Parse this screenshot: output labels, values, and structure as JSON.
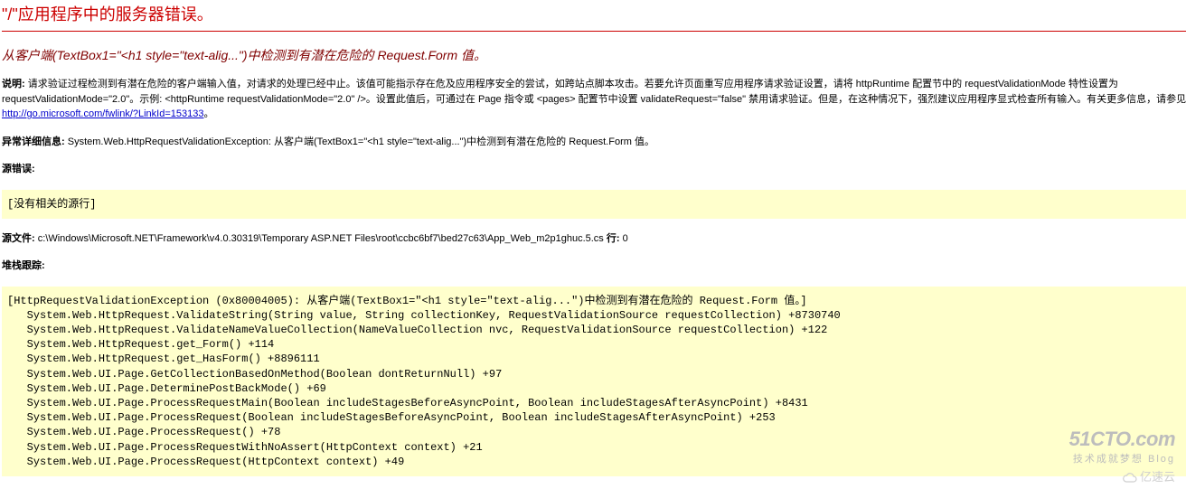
{
  "header": {
    "title": "\"/\"应用程序中的服务器错误。"
  },
  "subheader": {
    "text": "从客户端(TextBox1=\"<h1 style=\"text-alig...\")中检测到有潜在危险的 Request.Form 值。"
  },
  "description": {
    "label": "说明:",
    "part1": " 请求验证过程检测到有潜在危险的客户端输入值，对请求的处理已经中止。该值可能指示存在危及应用程序安全的尝试，如跨站点脚本攻击。若要允许页面重写应用程序请求验证设置，请将 httpRuntime 配置节中的 requestValidationMode 特性设置为 requestValidationMode=\"2.0\"。示例: <httpRuntime requestValidationMode=\"2.0\" />。设置此值后，可通过在 Page 指令或 <pages> 配置节中设置 validateRequest=\"false\" 禁用请求验证。但是，在这种情况下，强烈建议应用程序显式检查所有输入。有关更多信息，请参见 ",
    "link_text": "http://go.microsoft.com/fwlink/?LinkId=153133",
    "part2": "。"
  },
  "exception": {
    "label": "异常详细信息:",
    "text": " System.Web.HttpRequestValidationException: 从客户端(TextBox1=\"<h1 style=\"text-alig...\")中检测到有潜在危险的 Request.Form 值。"
  },
  "source_error": {
    "label": "源错误:",
    "code": "[没有相关的源行]"
  },
  "source_file": {
    "label": "源文件:",
    "path": " c:\\Windows\\Microsoft.NET\\Framework\\v4.0.30319\\Temporary ASP.NET Files\\root\\ccbc6bf7\\bed27c63\\App_Web_m2p1ghuc.5.cs",
    "line_label": "    行:",
    "line": " 0"
  },
  "stack_trace": {
    "label": "堆栈跟踪:",
    "code": "[HttpRequestValidationException (0x80004005): 从客户端(TextBox1=\"<h1 style=\"text-alig...\")中检测到有潜在危险的 Request.Form 值。]\n   System.Web.HttpRequest.ValidateString(String value, String collectionKey, RequestValidationSource requestCollection) +8730740\n   System.Web.HttpRequest.ValidateNameValueCollection(NameValueCollection nvc, RequestValidationSource requestCollection) +122\n   System.Web.HttpRequest.get_Form() +114\n   System.Web.HttpRequest.get_HasForm() +8896111\n   System.Web.UI.Page.GetCollectionBasedOnMethod(Boolean dontReturnNull) +97\n   System.Web.UI.Page.DeterminePostBackMode() +69\n   System.Web.UI.Page.ProcessRequestMain(Boolean includeStagesBeforeAsyncPoint, Boolean includeStagesAfterAsyncPoint) +8431\n   System.Web.UI.Page.ProcessRequest(Boolean includeStagesBeforeAsyncPoint, Boolean includeStagesAfterAsyncPoint) +253\n   System.Web.UI.Page.ProcessRequest() +78\n   System.Web.UI.Page.ProcessRequestWithNoAssert(HttpContext context) +21\n   System.Web.UI.Page.ProcessRequest(HttpContext context) +49"
  },
  "watermark": {
    "line1": "51CTO.com",
    "line2": "技术成就梦想 Blog",
    "line3": "亿速云"
  }
}
